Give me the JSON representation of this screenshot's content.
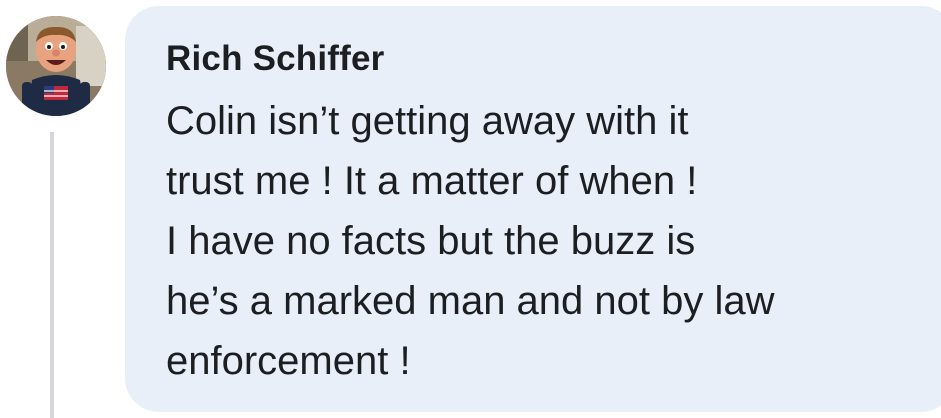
{
  "comment": {
    "author": "Rich Schiffer",
    "lines": [
      "Colin isn’t getting away with it",
      "trust me ! It a matter of when !",
      "I have no facts but the buzz is",
      "he’s a marked man and not by law",
      "enforcement !"
    ],
    "avatar_icon": "puppet-avatar-icon",
    "bubble_color": "#e8eff9"
  }
}
